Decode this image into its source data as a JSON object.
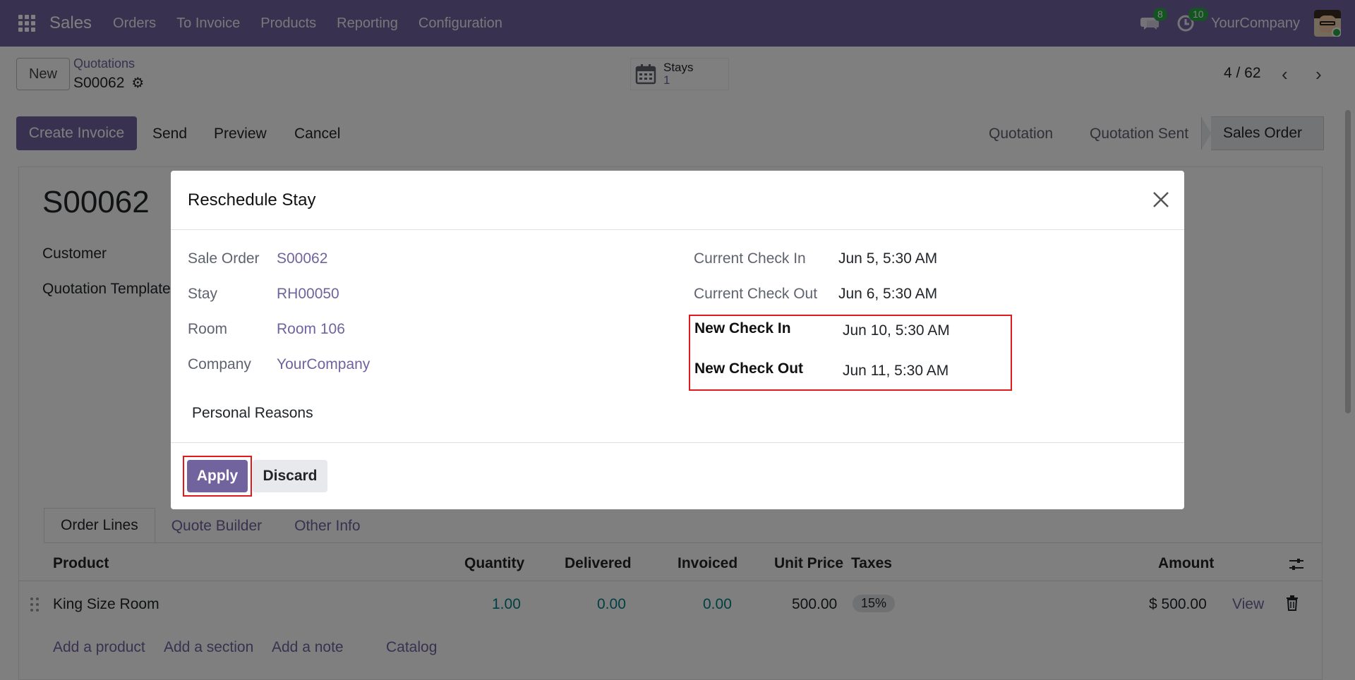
{
  "navbar": {
    "brand": "Sales",
    "menu": [
      "Orders",
      "To Invoice",
      "Products",
      "Reporting",
      "Configuration"
    ],
    "messages_count": "8",
    "activities_count": "10",
    "company": "YourCompany"
  },
  "control_panel": {
    "new_label": "New",
    "breadcrumb": "Quotations",
    "record_name": "S00062",
    "stays_label": "Stays",
    "stays_count": "1",
    "pager": "4 / 62"
  },
  "actions": {
    "create_invoice": "Create Invoice",
    "send": "Send",
    "preview": "Preview",
    "cancel": "Cancel"
  },
  "statusbar": {
    "steps": [
      "Quotation",
      "Quotation Sent"
    ],
    "current": "Sales Order"
  },
  "form": {
    "name": "S00062",
    "labels": [
      "Customer",
      "Quotation Template"
    ],
    "tabs": [
      "Order Lines",
      "Quote Builder",
      "Other Info"
    ],
    "columns": {
      "product": "Product",
      "quantity": "Quantity",
      "delivered": "Delivered",
      "invoiced": "Invoiced",
      "unit_price": "Unit Price",
      "taxes": "Taxes",
      "amount": "Amount"
    },
    "line": {
      "product": "King Size Room",
      "quantity": "1.00",
      "delivered": "0.00",
      "invoiced": "0.00",
      "unit_price": "500.00",
      "tax": "15%",
      "amount": "$ 500.00",
      "view": "View"
    },
    "add_links": [
      "Add a product",
      "Add a section",
      "Add a note",
      "Catalog"
    ]
  },
  "modal": {
    "title": "Reschedule Stay",
    "left_fields": [
      {
        "label": "Sale Order",
        "value": "S00062"
      },
      {
        "label": "Stay",
        "value": "RH00050"
      },
      {
        "label": "Room",
        "value": "Room 106"
      },
      {
        "label": "Company",
        "value": "YourCompany"
      }
    ],
    "current_check_in_label": "Current Check In",
    "current_check_in": "Jun 5, 5:30 AM",
    "current_check_out_label": "Current Check Out",
    "current_check_out": "Jun 6, 5:30 AM",
    "new_check_in_label": "New Check In",
    "new_check_in": "Jun 10, 5:30 AM",
    "new_check_out_label": "New Check Out",
    "new_check_out": "Jun 11, 5:30 AM",
    "reason": "Personal Reasons",
    "apply": "Apply",
    "discard": "Discard"
  },
  "colors": {
    "brand": "#71639e",
    "highlight": "#e0191d",
    "link": "#017e84"
  }
}
